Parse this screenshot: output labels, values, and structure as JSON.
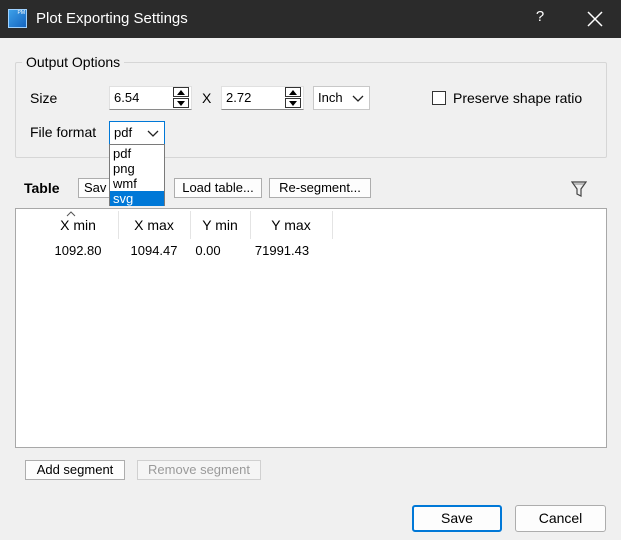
{
  "window": {
    "title": "Plot Exporting Settings",
    "help_label": "?"
  },
  "output_options": {
    "title": "Output Options",
    "size_label": "Size",
    "width_value": "6.54",
    "x_label": "X",
    "height_value": "2.72",
    "unit_value": "Inch",
    "preserve_label": "Preserve shape ratio",
    "preserve_checked": false,
    "file_format_label": "File format",
    "file_format_value": "pdf",
    "file_format_options": [
      "pdf",
      "png",
      "wmf",
      "svg"
    ],
    "highlighted_option": "svg"
  },
  "table_section": {
    "title": "Table",
    "save_table_label": "Sav",
    "load_table_label": "Load table...",
    "resegment_label": "Re-segment...",
    "columns": [
      "X min",
      "X max",
      "Y min",
      "Y max"
    ],
    "rows": [
      [
        "1092.80",
        "1094.47",
        "0.00",
        "71991.43"
      ]
    ]
  },
  "segment_buttons": {
    "add_label": "Add segment",
    "remove_label": "Remove segment"
  },
  "footer": {
    "save_label": "Save",
    "cancel_label": "Cancel"
  },
  "colors": {
    "titlebar": "#2b2b2b",
    "accent": "#0078d7"
  }
}
